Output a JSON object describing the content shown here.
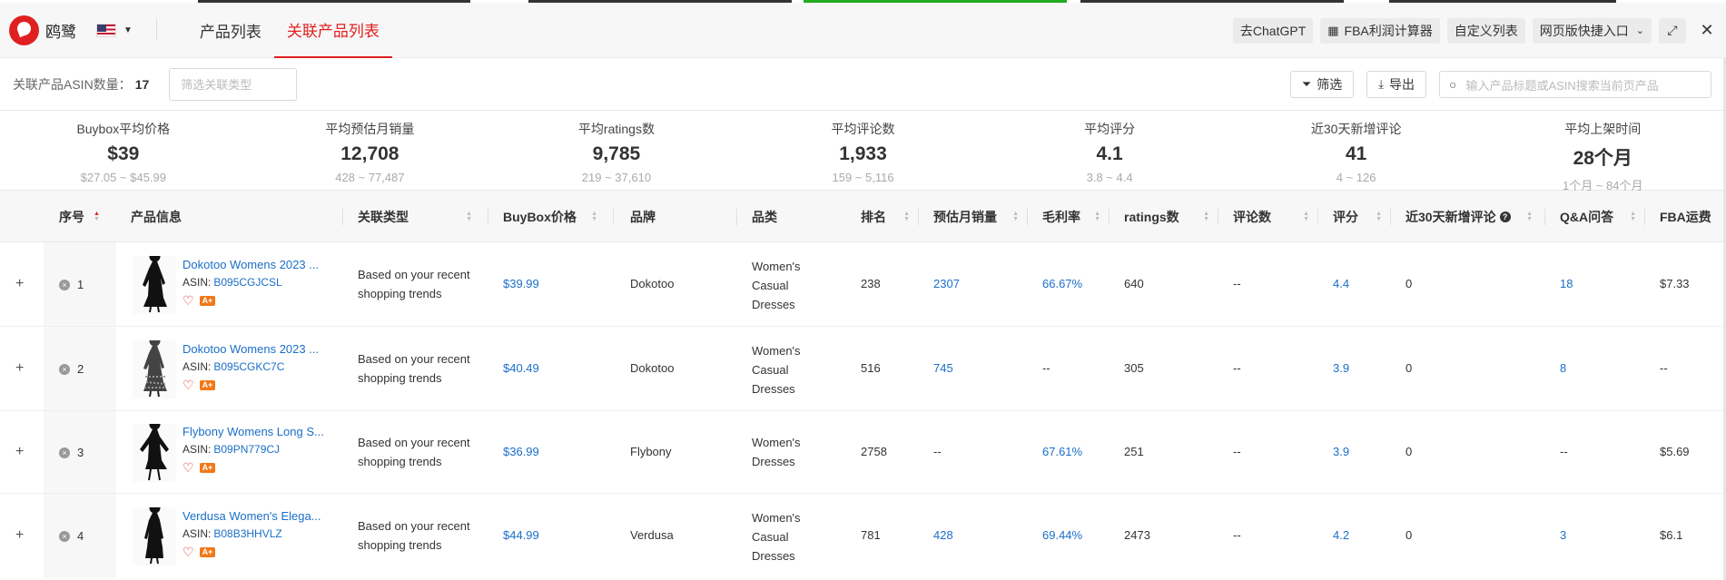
{
  "header": {
    "logo_text": "鸥鹭",
    "tabs": [
      {
        "label": "产品列表",
        "active": false
      },
      {
        "label": "关联产品列表",
        "active": true
      }
    ],
    "buttons": {
      "chatgpt": "去ChatGPT",
      "fba_calc": "FBA利润计算器",
      "custom_list": "自定义列表",
      "web_entry": "网页版快捷入口"
    }
  },
  "toolbar": {
    "asin_count_label": "关联产品ASIN数量：",
    "asin_count": "17",
    "filter_placeholder": "筛选关联类型",
    "filter_label": "筛选",
    "export_label": "导出",
    "search_placeholder": "输入产品标题或ASIN搜索当前页产品"
  },
  "stats": [
    {
      "title": "Buybox平均价格",
      "value": "$39",
      "range": "$27.05 ~ $45.99"
    },
    {
      "title": "平均预估月销量",
      "value": "12,708",
      "range": "428 ~ 77,487"
    },
    {
      "title": "平均ratings数",
      "value": "9,785",
      "range": "219 ~ 37,610"
    },
    {
      "title": "平均评论数",
      "value": "1,933",
      "range": "159 ~ 5,116"
    },
    {
      "title": "平均评分",
      "value": "4.1",
      "range": "3.8 ~ 4.4"
    },
    {
      "title": "近30天新增评论",
      "value": "41",
      "range": "4 ~ 126"
    },
    {
      "title": "平均上架时间",
      "value": "28个月",
      "range": "1个月 ~ 84个月"
    }
  ],
  "table": {
    "columns": {
      "seq": "序号",
      "product": "产品信息",
      "relation": "关联类型",
      "buybox": "BuyBox价格",
      "brand": "品牌",
      "category": "品类",
      "rank": "排名",
      "monthly_sales": "预估月销量",
      "margin": "毛利率",
      "ratings": "ratings数",
      "reviews": "评论数",
      "rating": "评分",
      "new_reviews": "近30天新增评论",
      "qa": "Q&A问答",
      "fba": "FBA运费"
    },
    "asin_label": "ASIN:",
    "aplus_badge": "A+",
    "rows": [
      {
        "seq": "1",
        "title": "Dokotoo Womens 2023 ...",
        "asin": "B095CGJCSL",
        "relation": [
          "Based on your recent",
          "shopping trends"
        ],
        "buybox": "$39.99",
        "brand": "Dokotoo",
        "category": [
          "Women's",
          "Casual",
          "Dresses"
        ],
        "rank": "238",
        "sales": "2307",
        "margin": "66.67%",
        "ratings": "640",
        "reviews": "--",
        "rating": "4.4",
        "new_reviews": "0",
        "qa": "18",
        "fba": "$7.33"
      },
      {
        "seq": "2",
        "title": "Dokotoo Womens 2023 ...",
        "asin": "B095CGKC7C",
        "relation": [
          "Based on your recent",
          "shopping trends"
        ],
        "buybox": "$40.49",
        "brand": "Dokotoo",
        "category": [
          "Women's",
          "Casual",
          "Dresses"
        ],
        "rank": "516",
        "sales": "745",
        "margin": "--",
        "ratings": "305",
        "reviews": "--",
        "rating": "3.9",
        "new_reviews": "0",
        "qa": "8",
        "fba": "--"
      },
      {
        "seq": "3",
        "title": "Flybony Womens Long S...",
        "asin": "B09PN779CJ",
        "relation": [
          "Based on your recent",
          "shopping trends"
        ],
        "buybox": "$36.99",
        "brand": "Flybony",
        "category": [
          "Women's",
          "Dresses"
        ],
        "rank": "2758",
        "sales": "--",
        "margin": "67.61%",
        "ratings": "251",
        "reviews": "--",
        "rating": "3.9",
        "new_reviews": "0",
        "qa": "--",
        "fba": "$5.69"
      },
      {
        "seq": "4",
        "title": "Verdusa Women's Elega...",
        "asin": "B08B3HHVLZ",
        "relation": [
          "Based on your recent",
          "shopping trends"
        ],
        "buybox": "$44.99",
        "brand": "Verdusa",
        "category": [
          "Women's",
          "Casual",
          "Dresses"
        ],
        "rank": "781",
        "sales": "428",
        "margin": "69.44%",
        "ratings": "2473",
        "reviews": "--",
        "rating": "4.2",
        "new_reviews": "0",
        "qa": "3",
        "fba": "$6.1"
      }
    ]
  }
}
